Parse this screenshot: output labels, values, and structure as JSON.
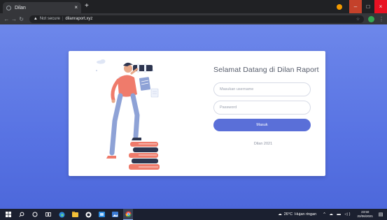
{
  "browser": {
    "tab_title": "Dilan",
    "tab_close": "×",
    "new_tab": "+",
    "security_label": "Not secure",
    "separator": "|",
    "url": "dilanraport.xyz",
    "window_min": "–",
    "window_max": "□",
    "window_close": "×",
    "icons": [
      "favicon-icon",
      "back-icon",
      "forward-icon",
      "reload-icon",
      "lock-warning-icon",
      "bookmark-icon",
      "profile-icon",
      "menu-icon",
      "extension-icon"
    ]
  },
  "login": {
    "title": "Selamat Datang di Dilan Raport",
    "username_placeholder": "Masukan username",
    "password_placeholder": "Password",
    "submit_label": "Masuk",
    "footer": "Dilan 2021"
  },
  "taskbar": {
    "temperature": "26°C",
    "weather": "Hujan ringan",
    "time": "23:50",
    "date": "22/06/2021",
    "icons": [
      "windows-start-icon",
      "search-icon",
      "cortana-icon",
      "task-view-icon",
      "edge-icon",
      "explorer-icon",
      "store-icon",
      "mail-icon",
      "photos-icon",
      "chrome-icon"
    ]
  },
  "colors": {
    "page_background": "#5c77e6",
    "card": "#ffffff",
    "button": "#5a6fd8",
    "title_text": "#555b6a"
  }
}
